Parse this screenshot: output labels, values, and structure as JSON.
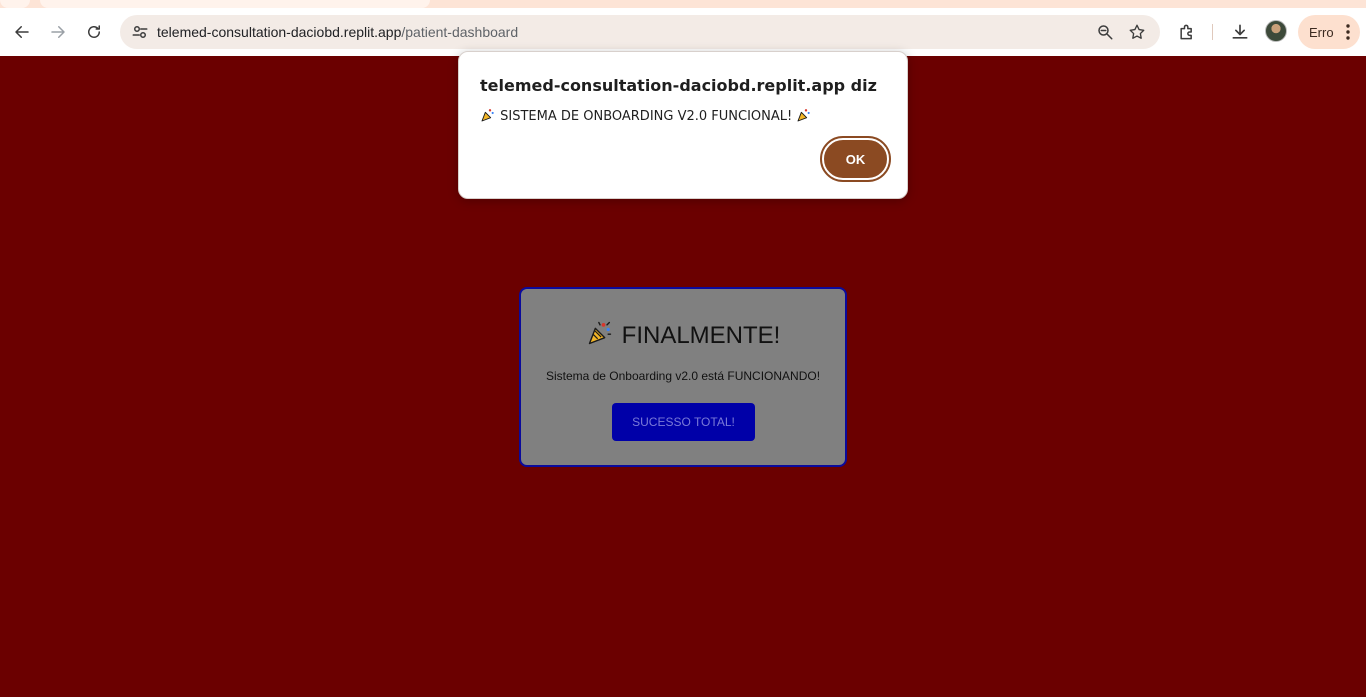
{
  "browser": {
    "url_host": "telemed-consultation-daciobd.replit.app",
    "url_path": "/patient-dashboard",
    "profile_chip_label": "Erro",
    "icons": [
      "back-icon",
      "forward-icon",
      "reload-icon",
      "site-info-icon",
      "zoom-icon",
      "bookmark-star-icon",
      "extensions-icon",
      "download-icon",
      "avatar",
      "menu-dots-icon"
    ]
  },
  "dialog": {
    "origin": "telemed-consultation-daciobd.replit.app diz",
    "message_icon": "party-popper-icon",
    "message": "SISTEMA DE ONBOARDING V2.0 FUNCIONAL!",
    "ok_label": "OK",
    "ok_color": "#8b4a22"
  },
  "card": {
    "title": "FINALMENTE!",
    "title_icon": "party-popper-icon",
    "subtitle": "Sistema de Onboarding v2.0 está FUNCIONANDO!",
    "button_label": "SUCESSO TOTAL!",
    "button_color": "#0000a8",
    "border_color": "#0a0a9c",
    "background": "#808080"
  },
  "page_background": "#6b0000"
}
